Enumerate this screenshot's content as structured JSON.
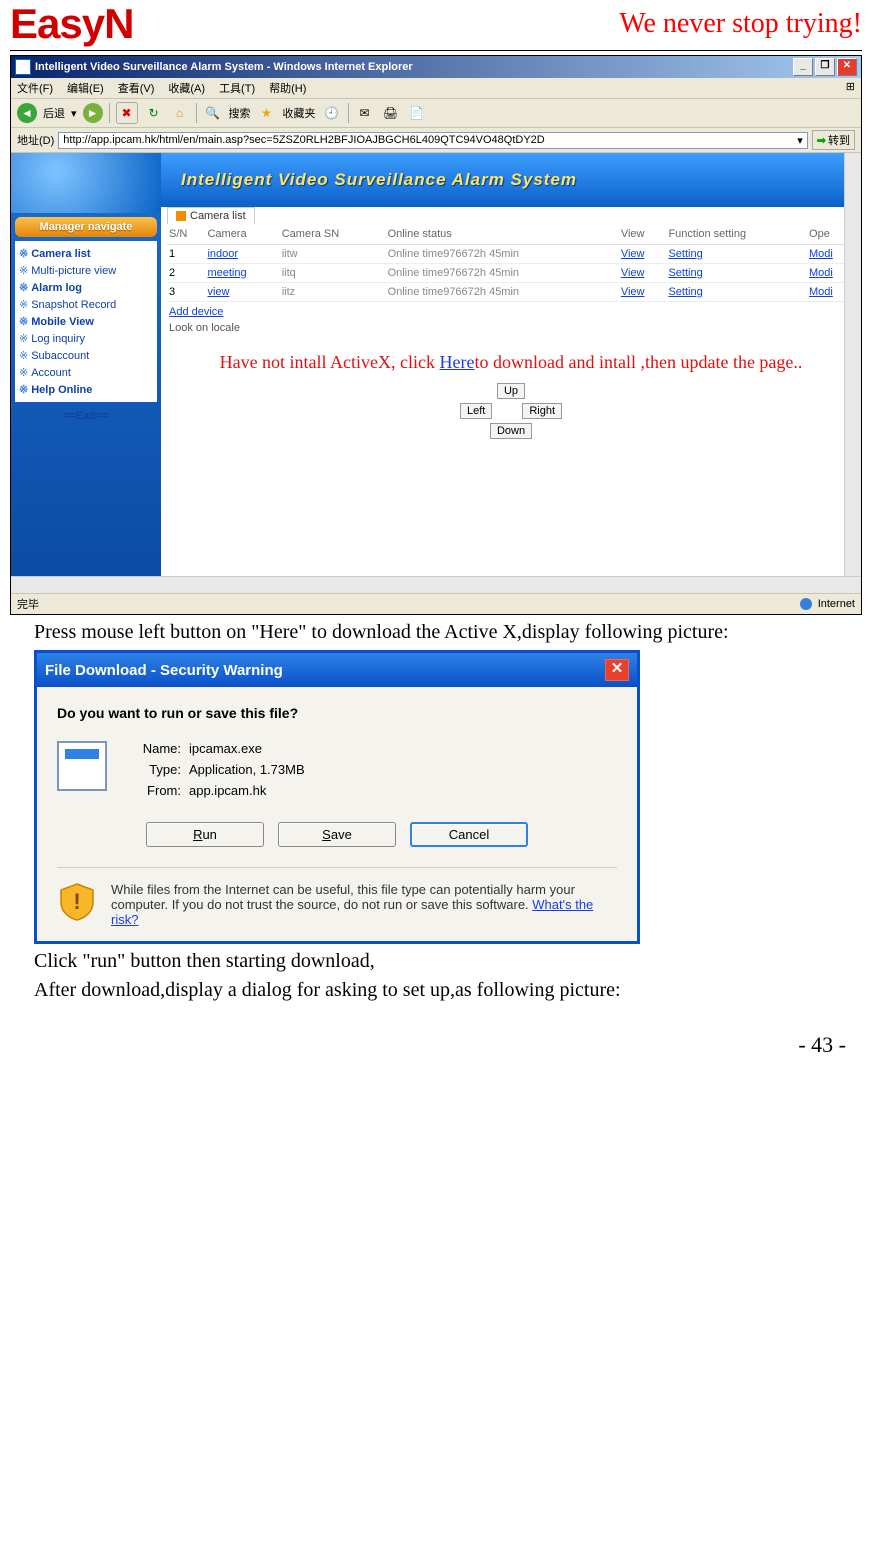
{
  "header": {
    "logo": "EasyN",
    "slogan": "We never stop trying!"
  },
  "ie": {
    "title": "Intelligent Video Surveillance Alarm System - Windows Internet Explorer",
    "menu": [
      "文件(F)",
      "编辑(E)",
      "查看(V)",
      "收藏(A)",
      "工具(T)",
      "帮助(H)"
    ],
    "back": "后退",
    "search": "搜索",
    "fav": "收藏夹",
    "addr_label": "地址(D)",
    "url": "http://app.ipcam.hk/html/en/main.asp?sec=5ZSZ0RLH2BFJIOAJBGCH6L409QTC94VO48QtDY2D",
    "go": "转到",
    "banner": "Intelligent Video Surveillance Alarm System",
    "nav_title": "Manager navigate",
    "nav_items": [
      {
        "label": "Camera list",
        "bold": true
      },
      {
        "label": "Multi-picture view",
        "bold": false
      },
      {
        "label": "Alarm log",
        "bold": true
      },
      {
        "label": "Snapshot Record",
        "bold": false
      },
      {
        "label": "Mobile View",
        "bold": true
      },
      {
        "label": "Log inquiry",
        "bold": false
      },
      {
        "label": "Subaccount",
        "bold": false
      },
      {
        "label": "Account",
        "bold": false
      },
      {
        "label": "Help Online",
        "bold": true
      }
    ],
    "nav_exit": "==Exit==",
    "tab_label": "Camera list",
    "cols": [
      "S/N",
      "Camera",
      "Camera SN",
      "Online status",
      "View",
      "Function setting",
      "Ope"
    ],
    "rows": [
      {
        "sn": "1",
        "cam": "indoor",
        "csn": "iitw",
        "status": "Online time976672h 45min",
        "view": "View",
        "set": "Setting",
        "op": "Modi"
      },
      {
        "sn": "2",
        "cam": "meeting",
        "csn": "iitq",
        "status": "Online time976672h 45min",
        "view": "View",
        "set": "Setting",
        "op": "Modi"
      },
      {
        "sn": "3",
        "cam": "view",
        "csn": "iitz",
        "status": "Online time976672h 45min",
        "view": "View",
        "set": "Setting",
        "op": "Modi"
      }
    ],
    "add_device": "Add device",
    "look_locale": "Look on locale",
    "activex_pre": "Have not intall ActiveX, click ",
    "activex_here": "Here",
    "activex_post": "to download and intall ,then update the page..",
    "dir": {
      "up": "Up",
      "down": "Down",
      "left": "Left",
      "right": "Right"
    },
    "status_done": "完毕",
    "status_net": "Internet"
  },
  "text1": "Press mouse left button on \"Here\" to download the Active X,display following picture:",
  "dlg": {
    "title": "File Download - Security Warning",
    "q": "Do you want to run or save this file?",
    "name_k": "Name:",
    "name_v": "ipcamax.exe",
    "type_k": "Type:",
    "type_v": "Application, 1.73MB",
    "from_k": "From:",
    "from_v": "app.ipcam.hk",
    "run": "Run",
    "save": "Save",
    "cancel": "Cancel",
    "warn": "While files from the Internet can be useful, this file type can potentially harm your computer. If you do not trust the source, do not run or save this software. ",
    "risk": "What's the risk?"
  },
  "text2": "Click \"run\" button then starting download,",
  "text3": "After download,display a dialog for asking to set up,as following picture:",
  "pagenum": "- 43 -"
}
